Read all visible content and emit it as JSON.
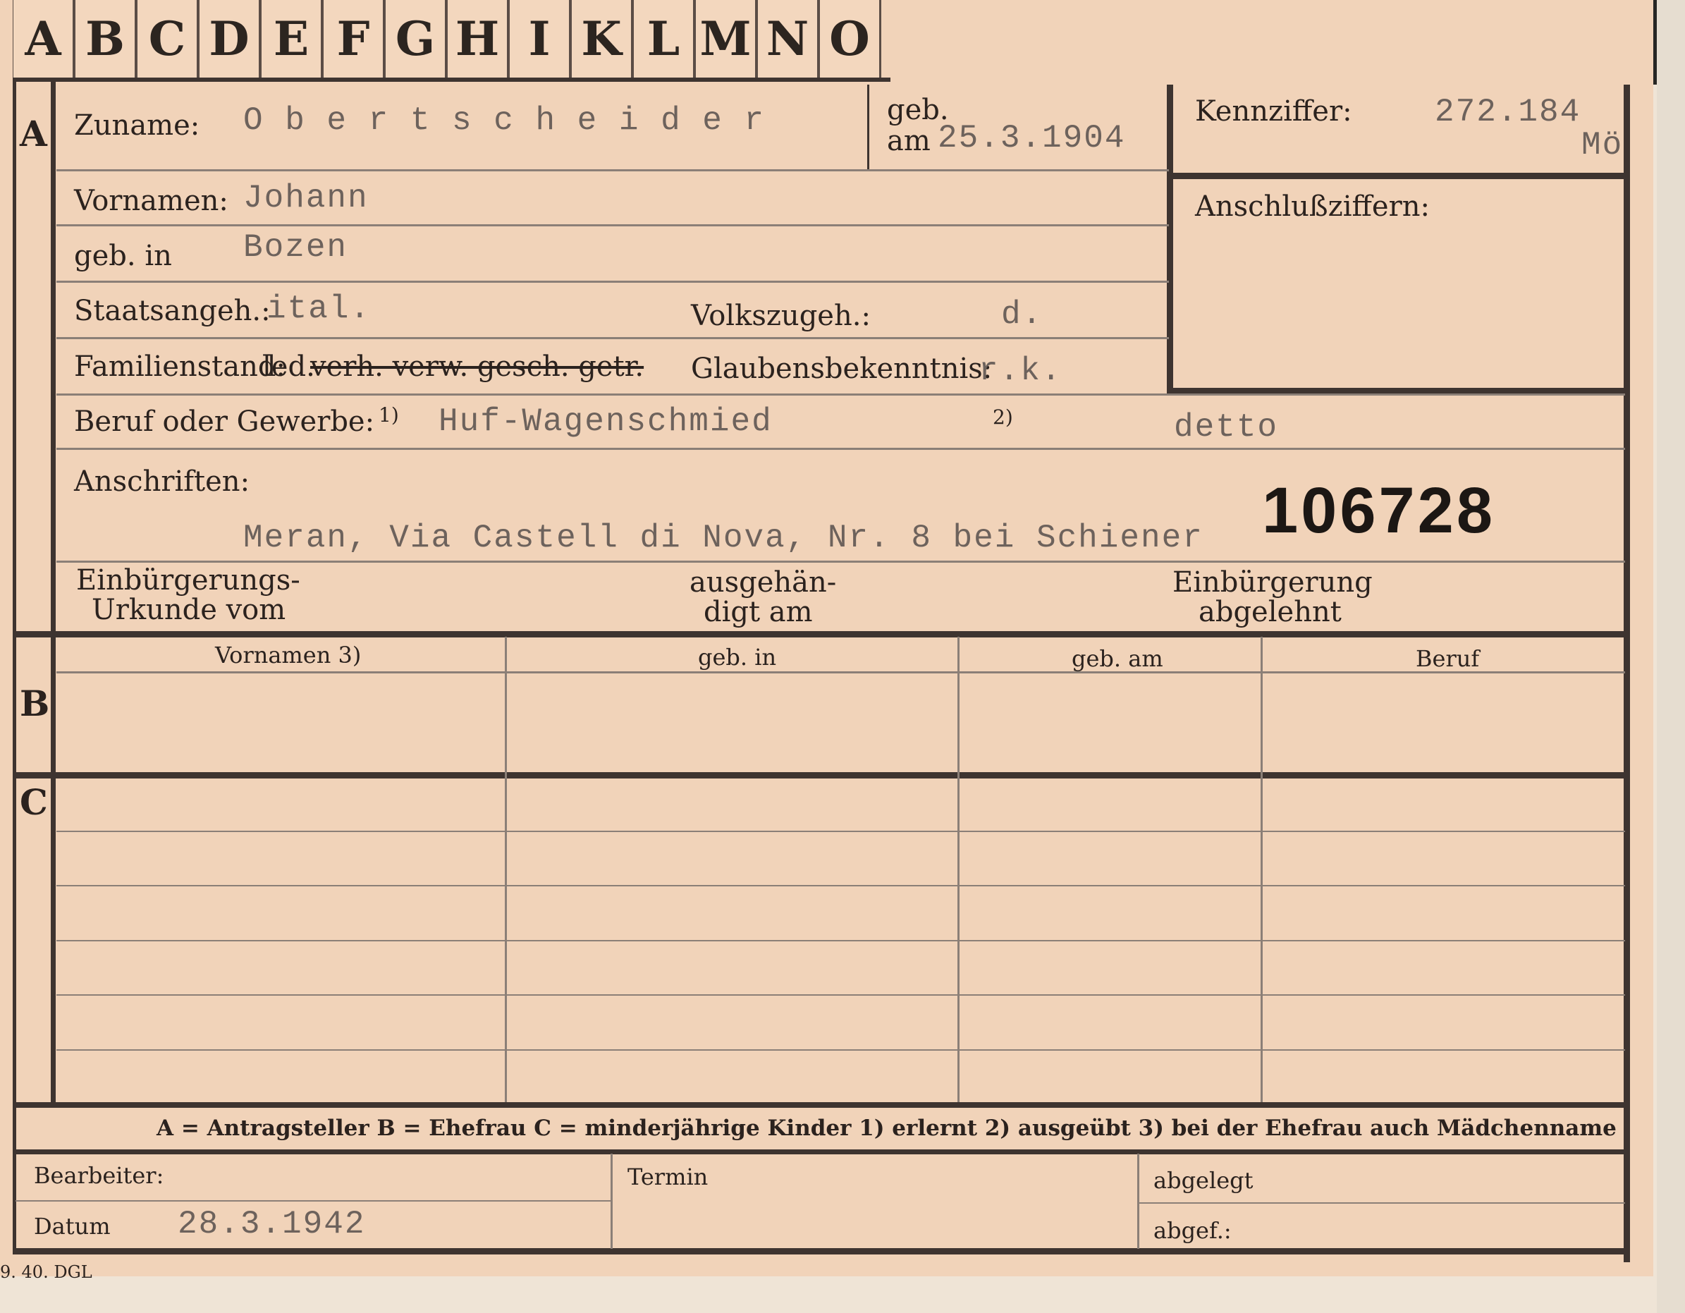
{
  "tabs": [
    "A",
    "B",
    "C",
    "D",
    "E",
    "F",
    "G",
    "H",
    "I",
    "K",
    "L",
    "M",
    "N",
    "O"
  ],
  "section_a": {
    "marker": "A",
    "zuname_label": "Zuname:",
    "zuname_value": "O b e r t s c h e i d e r",
    "geb_label": "geb.",
    "geb_am_label": "am",
    "geb_am_value": "25.3.1904",
    "kennziffer_label": "Kennziffer:",
    "kennziffer_value": "272.184",
    "kennziffer_suffix": "Mö",
    "anschluss_label": "Anschlußziffern:",
    "vornamen_label": "Vornamen:",
    "vornamen_value": "Johann",
    "geb_in_label": "geb. in",
    "geb_in_value": "Bozen",
    "staats_label": "Staatsangeh.:",
    "staats_value": "ital.",
    "volks_label": "Volkszugeh.:",
    "volks_value": "d.",
    "familien_label": "Familienstand:",
    "familien_led": "led.",
    "familien_struck": "verh. verw. gesch. getr.",
    "glauben_label": "Glaubensbekenntnis:",
    "glauben_value": "r.k.",
    "beruf_label": "Beruf oder Gewerbe:",
    "beruf_note1": "1)",
    "beruf_value1": "Huf-Wagenschmied",
    "beruf_note2": "2)",
    "beruf_value2": "detto",
    "anschriften_label": "Anschriften:",
    "anschriften_value": "Meran, Via Castell di Nova, Nr. 8 bei Schiener",
    "stamp_number": "106728",
    "einb_urkunde_1": "Einbürgerungs-",
    "einb_urkunde_2": "Urkunde vom",
    "ausgehaend_1": "ausgehän-",
    "ausgehaend_2": "digt am",
    "einb_abgelehnt_1": "Einbürgerung",
    "einb_abgelehnt_2": "abgelehnt"
  },
  "section_b": {
    "marker": "B",
    "headers": [
      "Vornamen 3)",
      "geb. in",
      "geb. am",
      "Beruf"
    ]
  },
  "section_c": {
    "marker": "C"
  },
  "legend": "A = Antragsteller   B = Ehefrau   C = minderjährige Kinder   1) erlernt   2) ausgeübt   3) bei der Ehefrau auch Mädchenname",
  "footer": {
    "bearbeiter_label": "Bearbeiter:",
    "datum_label": "Datum",
    "datum_value": "28.3.1942",
    "termin_label": "Termin",
    "abgelegt_label": "abgelegt",
    "abgef_label": "abgef.:"
  },
  "print_code": "9. 40. DGL"
}
